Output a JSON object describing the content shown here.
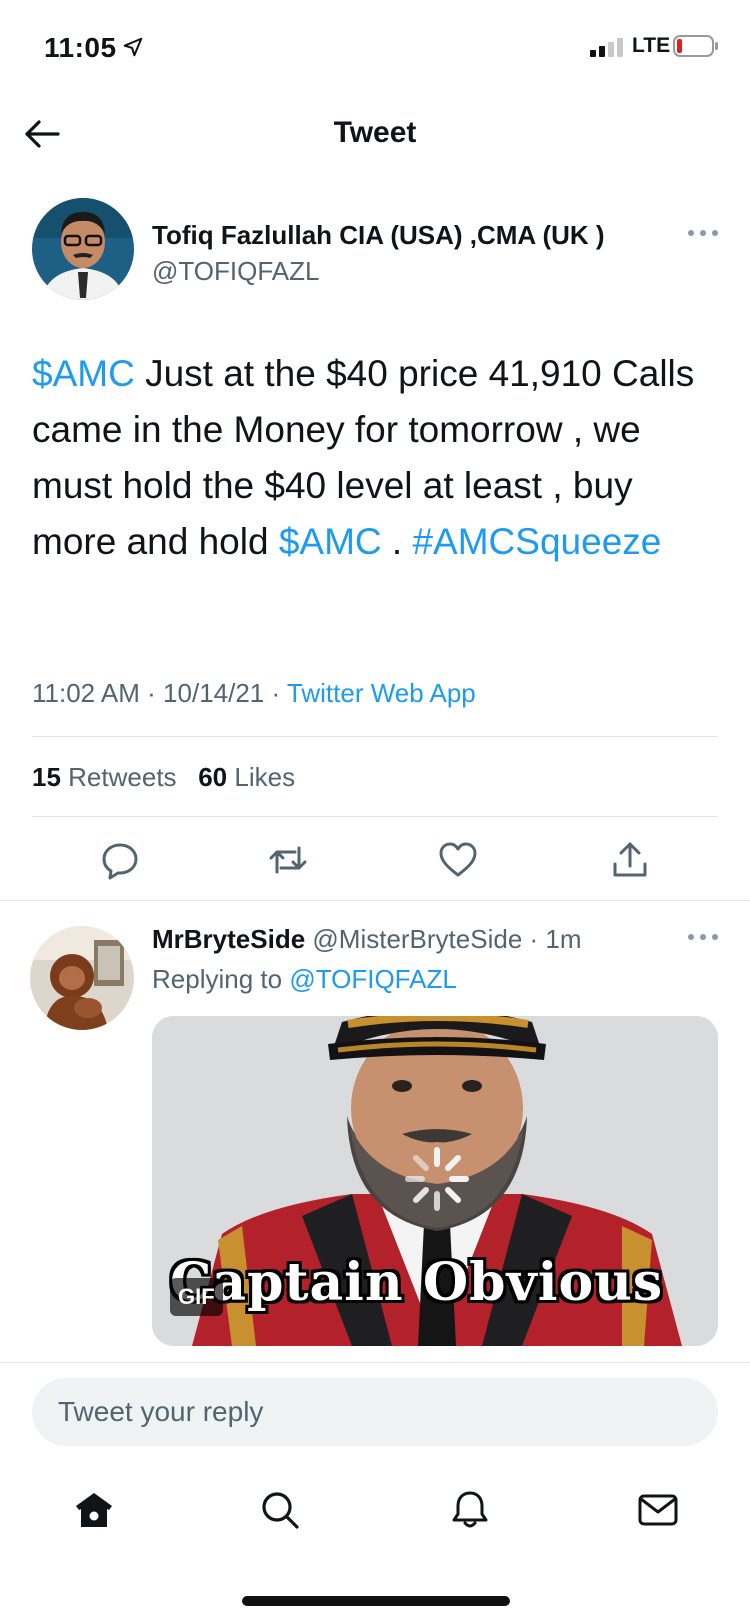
{
  "status_bar": {
    "time": "11:05",
    "network": "LTE",
    "location_icon": "location-arrow-icon",
    "signal_icon": "signal-icon",
    "battery_icon": "battery-low-icon"
  },
  "header": {
    "title": "Tweet",
    "back_icon": "arrow-left-icon"
  },
  "tweet": {
    "author_name": "Tofiq Fazlullah CIA (USA) ,CMA (UK )",
    "author_handle": "@TOFIQFAZL",
    "text_parts": {
      "p1": "$AMC",
      "p2": " Just at the $40 price 41,910 Calls came in the Money for tomorrow , we must hold the $40 level at least , buy more and hold ",
      "p3": "$AMC",
      "p4": " . ",
      "p5": "#AMCSqueeze"
    },
    "time": "11:02 AM",
    "date": "10/14/21",
    "source": "Twitter Web App",
    "retweets_count": "15",
    "retweets_label": "Retweets",
    "likes_count": "60",
    "likes_label": "Likes"
  },
  "reply": {
    "author_name": "MrBryteSide",
    "author_handle": "@MisterBryteSide",
    "time": "1m",
    "replying_label": "Replying to",
    "replying_to": "@TOFIQFAZL",
    "gif_caption": "Captain Obvious",
    "gif_badge": "GIF"
  },
  "composer": {
    "placeholder": "Tweet your reply"
  },
  "colors": {
    "accent": "#1d9bf0",
    "secondary_text": "#536471",
    "primary_text": "#0f1419"
  },
  "tab_bar": [
    "home-icon",
    "search-icon",
    "notifications-icon",
    "messages-icon"
  ]
}
